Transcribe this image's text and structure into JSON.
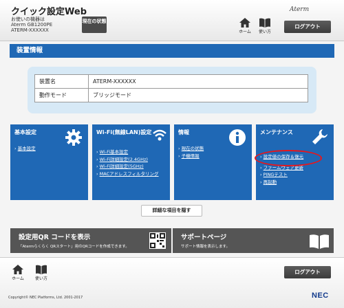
{
  "header": {
    "title": "クイック設定Web",
    "device_label": "お使いの機器は",
    "device_model": "Aterm GB1200PE",
    "device_name": "ATERM-XXXXXX",
    "status_button": "現在の状態",
    "logo": "Aterm",
    "home_label": "ホーム",
    "help_label": "使い方",
    "logout_label": "ログアウト"
  },
  "section": {
    "title": "装置情報"
  },
  "info_table": [
    {
      "key": "装置名",
      "value": "ATERM-XXXXXX"
    },
    {
      "key": "動作モード",
      "value": "ブリッジモード"
    }
  ],
  "tiles": [
    {
      "title": "基本設定",
      "icon": "gear-icon",
      "items": [
        "基本設定"
      ]
    },
    {
      "title": "Wi-Fi(無線LAN)設定",
      "icon": "wifi-icon",
      "items": [
        "Wi-Fi基本設定",
        "Wi-Fi詳細設定(2.4GHz)",
        "Wi-Fi詳細設定(5GHz)",
        "MACアドレスフィルタリング"
      ]
    },
    {
      "title": "情報",
      "icon": "info-icon",
      "items": [
        "現在の状態",
        "子機情報"
      ]
    },
    {
      "title": "メンテナンス",
      "icon": "wrench-icon",
      "items": [
        "設定値の保存＆復元",
        "ファームウェア更新",
        "PINGテスト",
        "再起動"
      ]
    }
  ],
  "more_button": "詳細な項目を隠す",
  "banners": {
    "qr_title": "設定用QR コードを表示",
    "qr_sub": "「Atermらくらく QRスタート」用のQRコードを作成できます。",
    "support_title": "サポートページ",
    "support_sub": "サポート情報を表示します。"
  },
  "footer": {
    "home_label": "ホーム",
    "help_label": "使い方",
    "logout_label": "ログアウト",
    "copyright": "Copyright© NEC Platforms, Ltd. 2001-2017",
    "brand": "NEC"
  },
  "colors": {
    "accent": "#1f68b5",
    "dark_button": "#4b4b4b",
    "highlight": "#e8161b"
  }
}
